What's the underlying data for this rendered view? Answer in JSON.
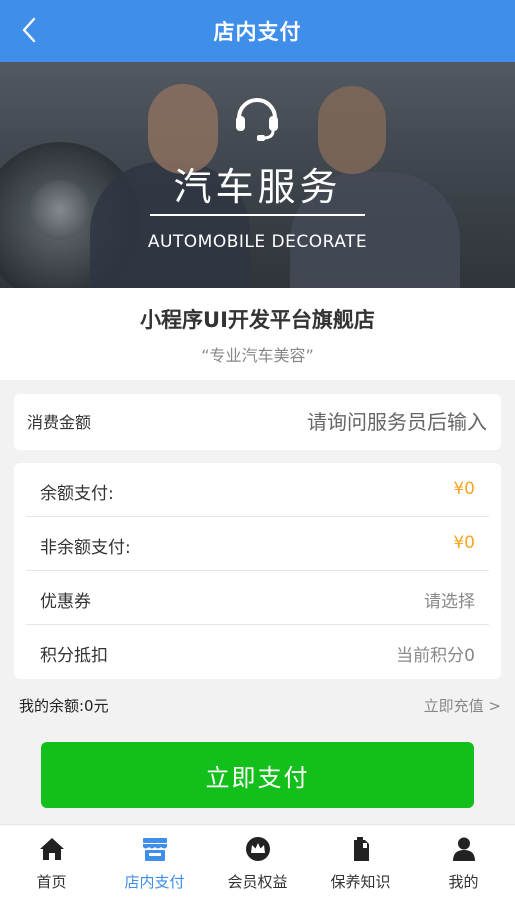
{
  "header": {
    "title": "店内支付"
  },
  "banner": {
    "title": "汽车服务",
    "subtitle": "AUTOMOBILE DECORATE",
    "icon": "headset-icon"
  },
  "store": {
    "name": "小程序UI开发平台旗舰店",
    "slogan": "“专业汽车美容”"
  },
  "amount": {
    "label": "消费金额",
    "placeholder": "请询问服务员后输入",
    "value": ""
  },
  "payment": {
    "rows": [
      {
        "label": "余额支付:",
        "value": "¥0"
      },
      {
        "label": "非余额支付:",
        "value": "¥0"
      },
      {
        "label": "优惠券",
        "value": "请选择"
      },
      {
        "label": "积分抵扣",
        "value": "当前积分0"
      }
    ]
  },
  "balance": {
    "text": "我的余额:0元",
    "recharge": "立即充值 >"
  },
  "pay_button": "立即支付",
  "tabbar": {
    "items": [
      {
        "label": "首页",
        "icon": "home-icon"
      },
      {
        "label": "店内支付",
        "icon": "store-icon"
      },
      {
        "label": "会员权益",
        "icon": "crown-icon"
      },
      {
        "label": "保养知识",
        "icon": "oil-can-icon"
      },
      {
        "label": "我的",
        "icon": "user-icon"
      }
    ],
    "active_index": 1
  },
  "colors": {
    "header_bg": "#3f8ee9",
    "accent_orange": "#f5a623",
    "pay_green": "#12bf1b",
    "tab_active": "#3f8ee9"
  }
}
